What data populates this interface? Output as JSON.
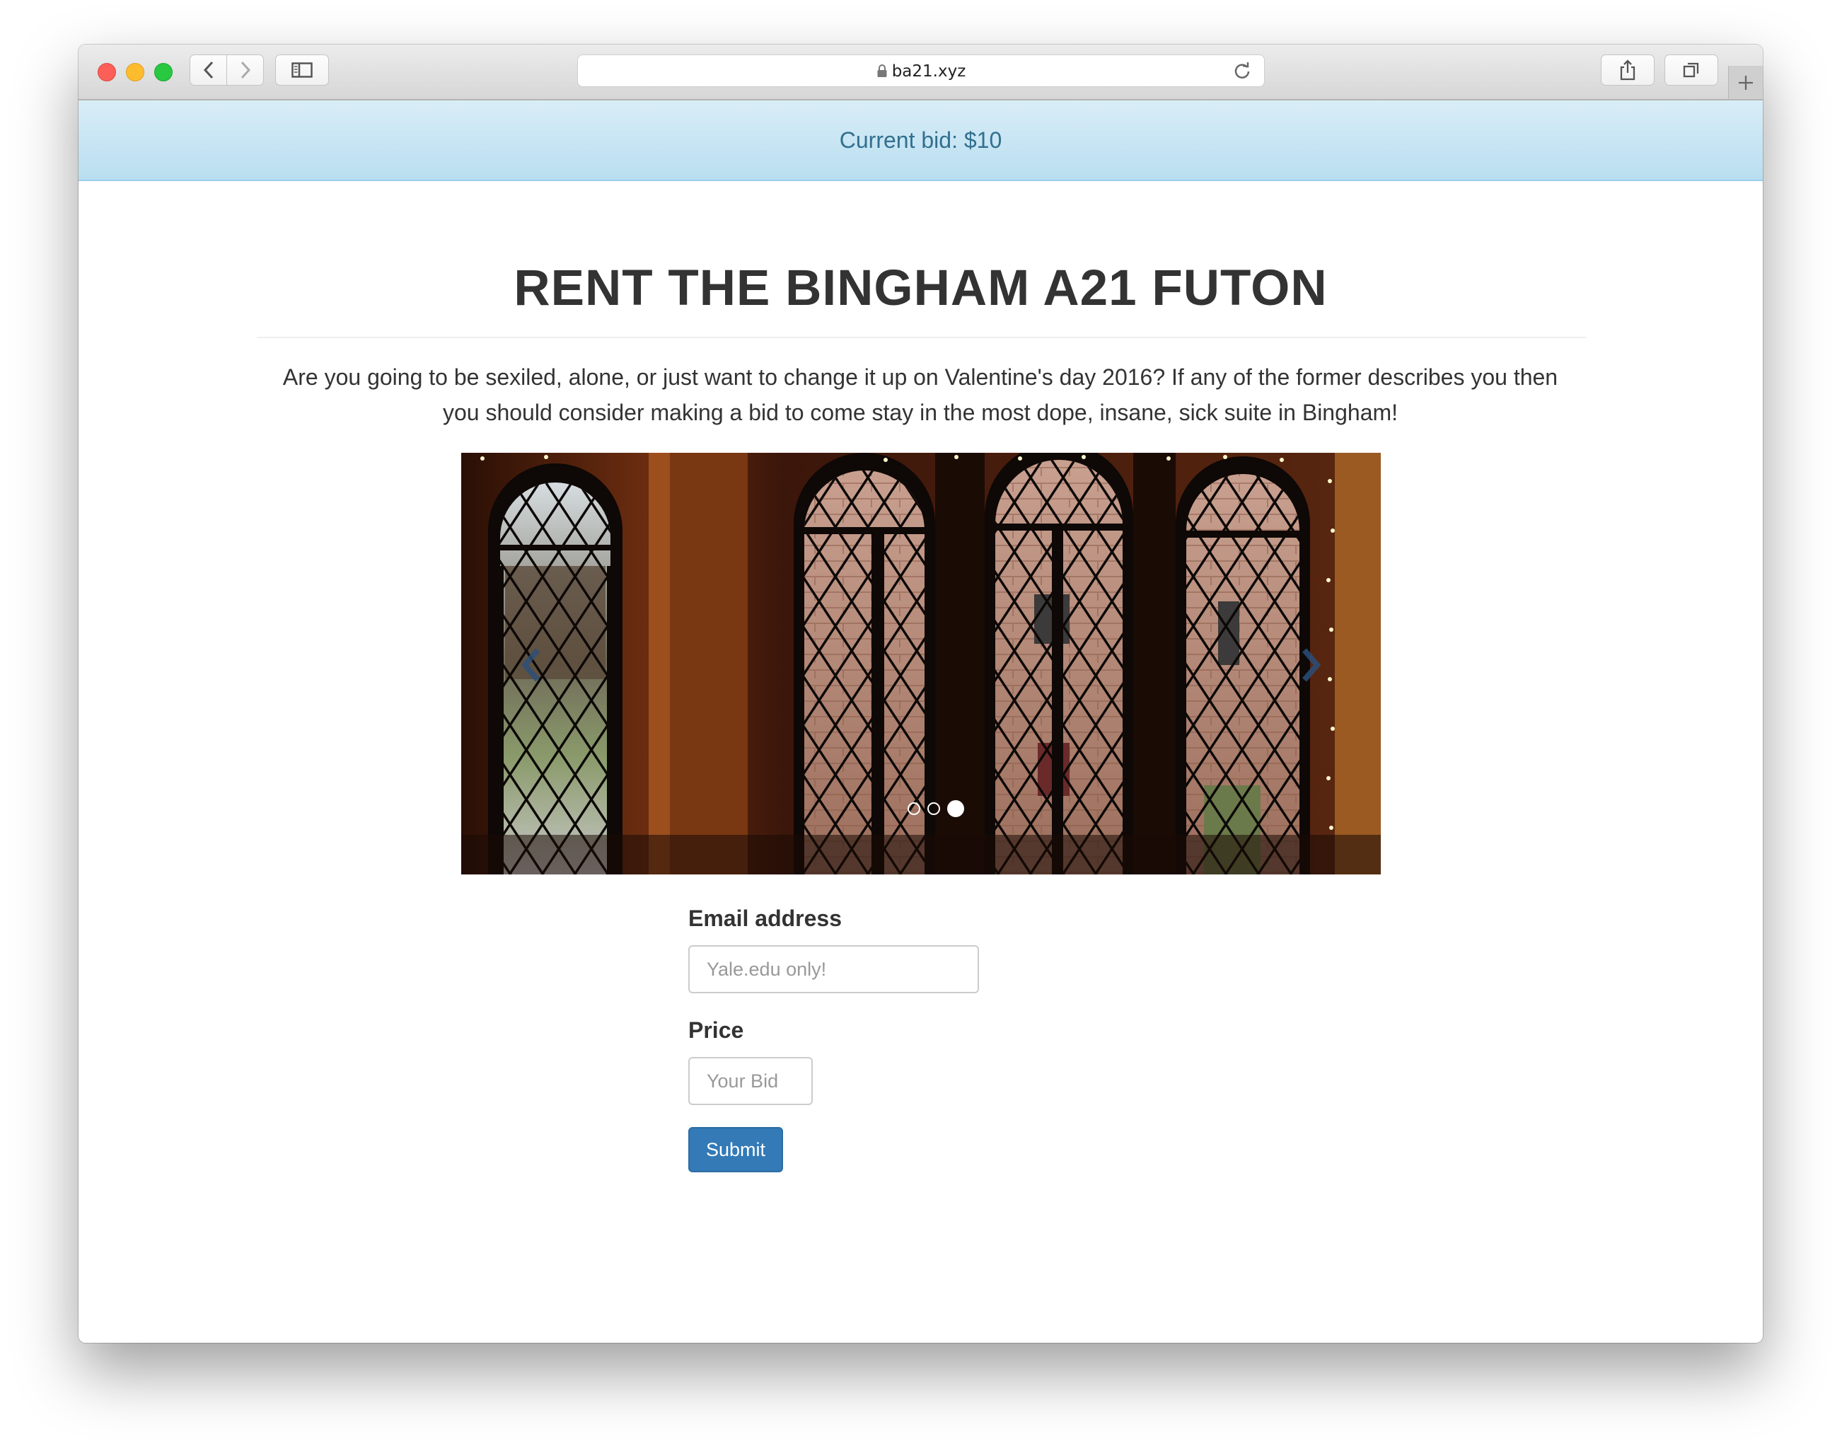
{
  "browser": {
    "url": "ba21.xyz"
  },
  "alert": {
    "text": "Current bid: $10"
  },
  "page": {
    "title": "RENT THE BINGHAM A21 FUTON",
    "lead": "Are you going to be sexiled, alone, or just want to change it up on Valentine's day 2016? If any of the former describes you then you should consider making a bid to come stay in the most dope, insane, sick suite in Bingham!"
  },
  "carousel": {
    "slide_count": 3,
    "active_slide": 3
  },
  "form": {
    "email_label": "Email address",
    "email_placeholder": "Yale.edu only!",
    "email_value": "",
    "price_label": "Price",
    "price_placeholder": "Your Bid",
    "price_value": "",
    "submit_label": "Submit"
  }
}
